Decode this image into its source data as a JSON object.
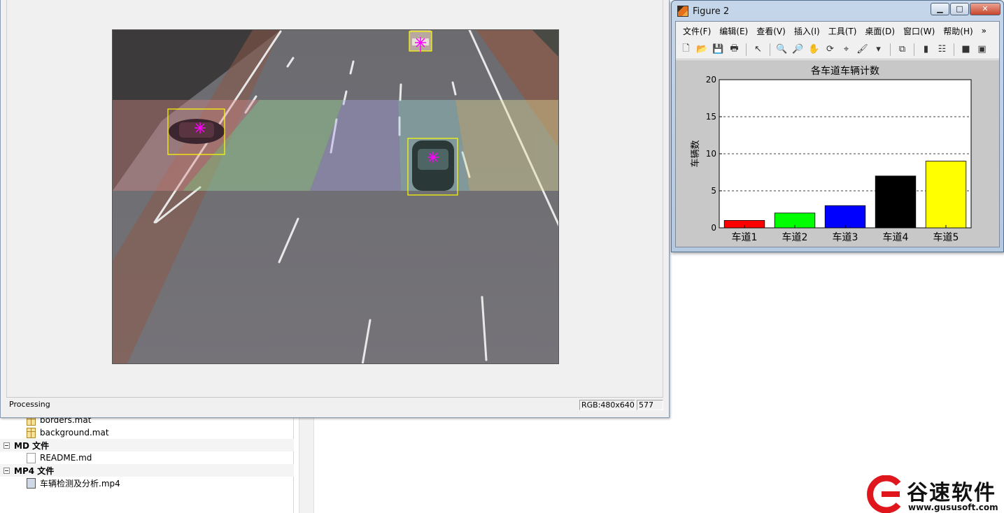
{
  "file_tree": {
    "items": [
      {
        "kind": "file",
        "icon": "mat-file-icon",
        "label": "borders.mat"
      },
      {
        "kind": "file",
        "icon": "mat-file-icon",
        "label": "background.mat"
      },
      {
        "kind": "group",
        "label": "MD 文件"
      },
      {
        "kind": "file",
        "icon": "md-file-icon",
        "label": "README.md"
      },
      {
        "kind": "group",
        "label": "MP4 文件"
      },
      {
        "kind": "file",
        "icon": "mp4-file-icon",
        "label": "车辆检测及分析.mp4"
      }
    ]
  },
  "figure1": {
    "status": "Processing",
    "image_info": "RGB:480x640",
    "frame_number": "577"
  },
  "figure2": {
    "title": "Figure 2",
    "window_buttons": {
      "minimize": "▁",
      "maximize": "□",
      "close": "✕"
    },
    "menu": [
      "文件(F)",
      "编辑(E)",
      "查看(V)",
      "插入(I)",
      "工具(T)",
      "桌面(D)",
      "窗口(W)",
      "帮助(H)",
      "»"
    ],
    "toolbar": [
      {
        "name": "new-figure-icon",
        "glyph": "🗋"
      },
      {
        "name": "open-file-icon",
        "glyph": "📂"
      },
      {
        "name": "save-icon",
        "glyph": "💾"
      },
      {
        "name": "print-icon",
        "glyph": "🖶"
      },
      {
        "sep": true
      },
      {
        "name": "edit-plot-arrow-icon",
        "glyph": "↖"
      },
      {
        "sep": true
      },
      {
        "name": "zoom-in-icon",
        "glyph": "🔍"
      },
      {
        "name": "zoom-out-icon",
        "glyph": "🔎"
      },
      {
        "name": "pan-hand-icon",
        "glyph": "✋"
      },
      {
        "name": "rotate-3d-icon",
        "glyph": "⟳"
      },
      {
        "name": "data-cursor-icon",
        "glyph": "⌖"
      },
      {
        "name": "brush-icon",
        "glyph": "🖌"
      },
      {
        "name": "brush-dropdown-icon",
        "glyph": "▾"
      },
      {
        "sep": true
      },
      {
        "name": "link-plot-icon",
        "glyph": "⧉"
      },
      {
        "sep": true
      },
      {
        "name": "colorbar-icon",
        "glyph": "▮"
      },
      {
        "name": "legend-icon",
        "glyph": "☷"
      },
      {
        "sep": true
      },
      {
        "name": "hide-plot-tools-icon",
        "glyph": "■"
      },
      {
        "name": "show-plot-tools-icon",
        "glyph": "▣"
      }
    ]
  },
  "video": {
    "lane_colors": [
      "#d88a8a",
      "#9fe39a",
      "#a9a3e6",
      "#9fd8d6",
      "#e6e09a"
    ],
    "box_color": "#ffff00",
    "marker_color": "#ff00ff"
  },
  "chart_data": {
    "type": "bar",
    "title": "各车道车辆计数",
    "ylabel": "车辆数",
    "xlabel": "",
    "categories": [
      "车道1",
      "车道2",
      "车道3",
      "车道4",
      "车道5"
    ],
    "values": [
      1,
      2,
      3,
      7,
      9
    ],
    "colors": [
      "#ff0000",
      "#00ff00",
      "#0000ff",
      "#000000",
      "#ffff00"
    ],
    "ylim": [
      0,
      20
    ],
    "yticks": [
      0,
      5,
      10,
      15,
      20
    ],
    "grid": "y-dashed"
  },
  "watermark": {
    "name": "谷速软件",
    "url": "www.gususoft.com"
  }
}
